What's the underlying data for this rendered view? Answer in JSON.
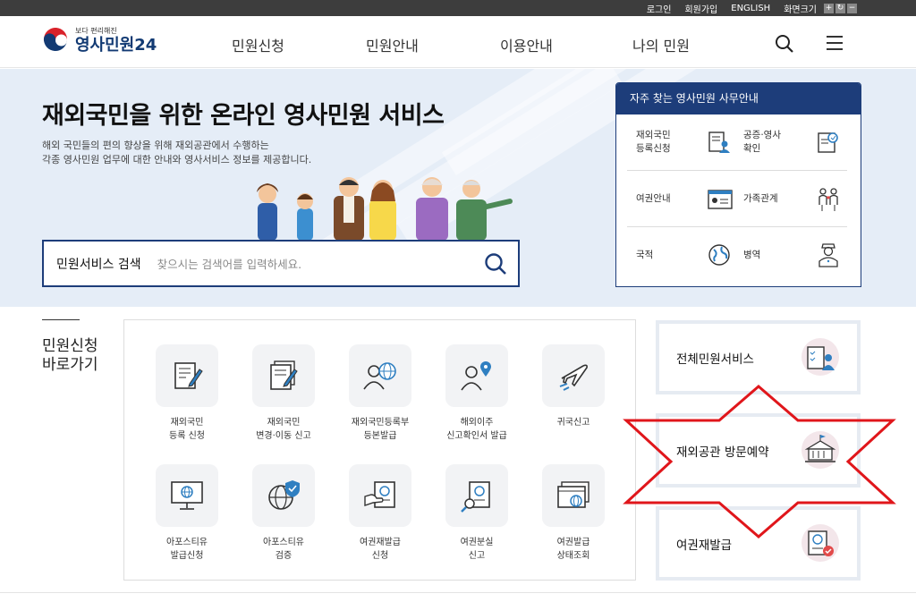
{
  "utility": {
    "login": "로그인",
    "join": "회원가입",
    "english": "ENGLISH",
    "font_size": "화면크기"
  },
  "header": {
    "logo_sub": "보다 편리해진",
    "logo_name": "영사민원24",
    "nav": [
      "민원신청",
      "민원안내",
      "이용안내",
      "나의 민원"
    ]
  },
  "hero": {
    "title": "재외국민을 위한 온라인 영사민원 서비스",
    "desc1": "해외 국민들의 편의 향상을 위해 재외공관에서 수행하는",
    "desc2": "각종 영사민원 업무에 대한 안내와 영사서비스 정보를 제공합니다.",
    "search_label": "민원서비스 검색",
    "search_placeholder": "찾으시는 검색어를 입력하세요."
  },
  "favorites": {
    "title": "자주 찾는 영사민원 사무안내",
    "items": [
      {
        "l1": "재외국민",
        "l2": "등록신청",
        "icon": "document-person-icon"
      },
      {
        "l1": "공증·영사",
        "l2": "확인",
        "icon": "certificate-icon"
      },
      {
        "l1": "여권안내",
        "l2": "",
        "icon": "passport-card-icon"
      },
      {
        "l1": "가족관계",
        "l2": "",
        "icon": "family-icon"
      },
      {
        "l1": "국적",
        "l2": "",
        "icon": "globe-icon"
      },
      {
        "l1": "병역",
        "l2": "",
        "icon": "soldier-icon"
      }
    ]
  },
  "quick": {
    "title1": "민원신청",
    "title2": "바로가기",
    "tiles": [
      {
        "l1": "재외국민",
        "l2": "등록 신청"
      },
      {
        "l1": "재외국민",
        "l2": "변경·이동 신고"
      },
      {
        "l1": "재외국민등록부",
        "l2": "등본발급"
      },
      {
        "l1": "해외이주",
        "l2": "신고확인서 발급"
      },
      {
        "l1": "귀국신고",
        "l2": ""
      },
      {
        "l1": "아포스티유",
        "l2": "발급신청"
      },
      {
        "l1": "아포스티유",
        "l2": "검증"
      },
      {
        "l1": "여권재발급",
        "l2": "신청"
      },
      {
        "l1": "여권분실",
        "l2": "신고"
      },
      {
        "l1": "여권발급",
        "l2": "상태조회"
      }
    ]
  },
  "services": [
    {
      "label": "전체민원서비스"
    },
    {
      "label": "재외공관 방문예약"
    },
    {
      "label": "여권재발급"
    }
  ],
  "colors": {
    "navy": "#1d3d7a",
    "hero_bg": "#e5edf7",
    "annotation": "#e0161b"
  }
}
